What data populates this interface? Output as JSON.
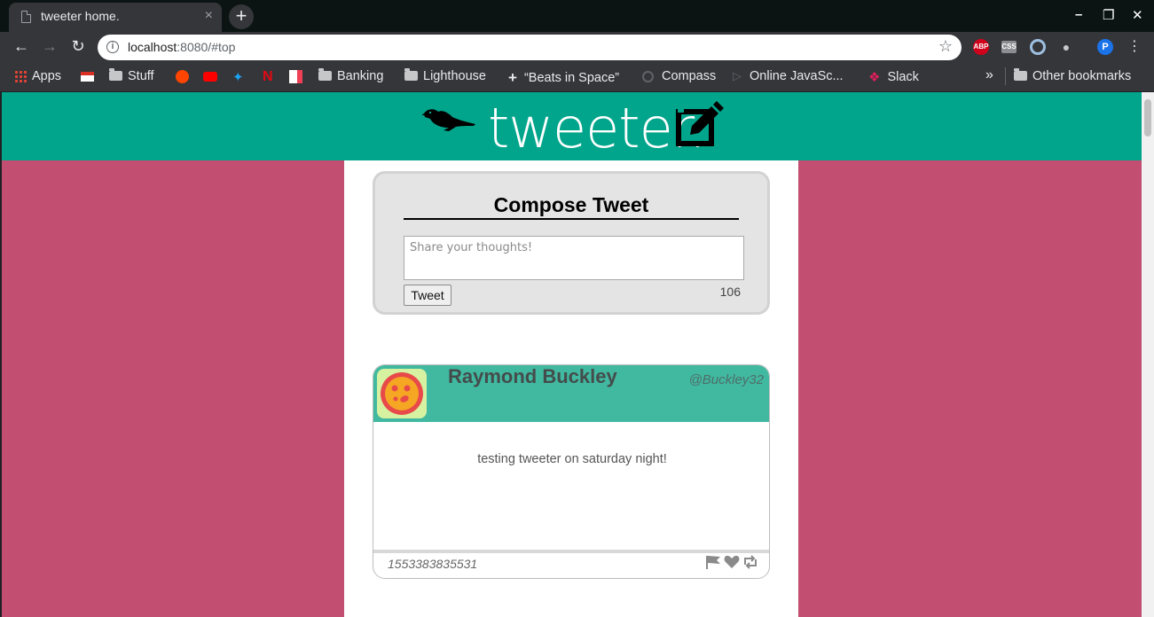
{
  "browser": {
    "tab_title": "tweeter home.",
    "tab_close": "×",
    "new_tab": "+",
    "url_host": "localhost",
    "url_rest": ":8080/#top",
    "window_controls": [
      "–",
      "❐",
      "✕"
    ]
  },
  "bookmarks": [
    {
      "label": "Apps",
      "icon": "apps-grid-icon"
    },
    {
      "label": "",
      "icon": "gmail-icon"
    },
    {
      "label": "Stuff",
      "icon": "folder-icon"
    },
    {
      "label": "",
      "icon": "reddit-icon"
    },
    {
      "label": "",
      "icon": "youtube-icon"
    },
    {
      "label": "",
      "icon": "twitter-icon"
    },
    {
      "label": "",
      "icon": "netflix-icon"
    },
    {
      "label": "",
      "icon": "pocket-icon"
    },
    {
      "label": "Banking",
      "icon": "folder-icon"
    },
    {
      "label": "Lighthouse",
      "icon": "folder-icon"
    },
    {
      "label": "“Beats in Space”",
      "icon": "plus-icon"
    },
    {
      "label": "Compass",
      "icon": "compass-icon"
    },
    {
      "label": "Online JavaSc...",
      "icon": "play-icon"
    },
    {
      "label": "Slack",
      "icon": "slack-icon"
    }
  ],
  "bookmarks_overflow": "»",
  "other_bookmarks": "Other bookmarks",
  "page": {
    "brand": "tweeter.",
    "compose": {
      "title": "Compose Tweet",
      "placeholder": "Share your thoughts!",
      "button_label": "Tweet",
      "counter": "106"
    },
    "tweet": {
      "name": "Raymond Buckley",
      "handle": "@Buckley32",
      "content": "testing tweeter on saturday night!",
      "timestamp": "1553383835531"
    }
  },
  "colors": {
    "nav_bg": "#01a58b",
    "page_bg": "#c24e72",
    "tweet_header": "#41b9a1"
  }
}
